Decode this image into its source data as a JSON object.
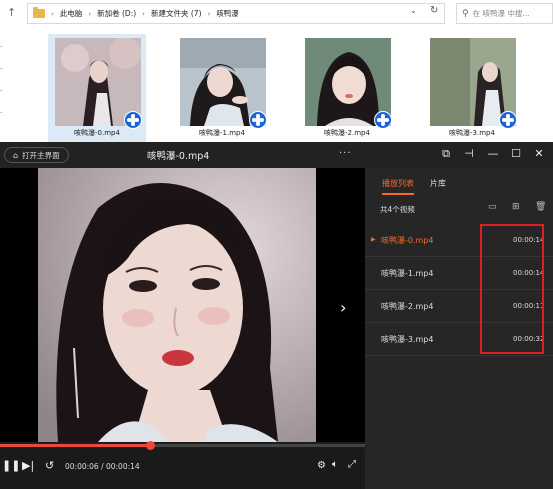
{
  "explorer": {
    "breadcrumbs": [
      "此电脑",
      "新加卷 (D:)",
      "新建文件夹 (7)",
      "咳鸭瀑"
    ],
    "search_placeholder": "在 咳鸭瀑 中搜...",
    "files": [
      {
        "name": "咳鸭瀑-0.mp4"
      },
      {
        "name": "咳鸭瀑-1.mp4"
      },
      {
        "name": "咳鸭瀑-2.mp4"
      },
      {
        "name": "咳鸭瀑-3.mp4"
      }
    ]
  },
  "player": {
    "home_label": "打开主界面",
    "title": "咳鸭瀑-0.mp4",
    "time_display": "00:00:06 / 00:00:14",
    "progress": 0.41,
    "accent_color": "#f26b2a",
    "tabs": [
      "播放列表",
      "片库"
    ],
    "count_label": "共4个视频",
    "playlist": [
      {
        "name": "咳鸭瀑-0.mp4",
        "duration": "00:00:14",
        "current": true
      },
      {
        "name": "咳鸭瀑-1.mp4",
        "duration": "00:00:14",
        "current": false
      },
      {
        "name": "咳鸭瀑-2.mp4",
        "duration": "00:00:11",
        "current": false
      },
      {
        "name": "咳鸭瀑-3.mp4",
        "duration": "00:00:32",
        "current": false
      }
    ]
  }
}
